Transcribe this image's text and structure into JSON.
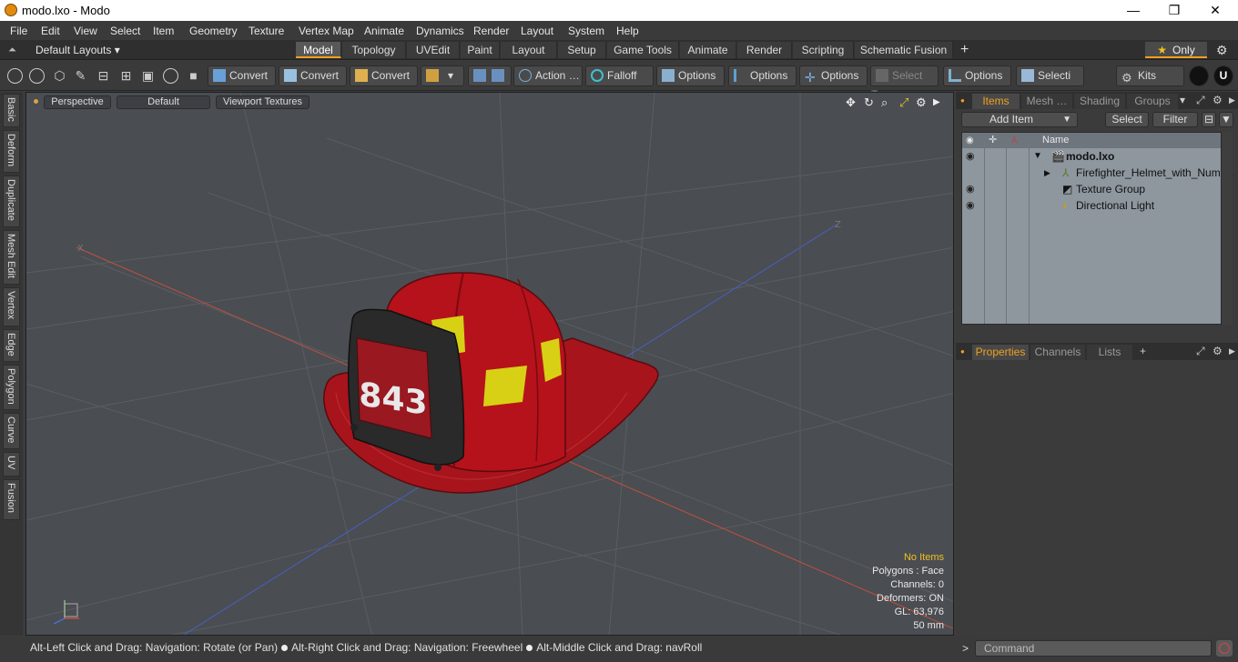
{
  "window": {
    "title": "modo.lxo - Modo",
    "minimize": "—",
    "maximize": "❐",
    "close": "✕"
  },
  "menu": [
    "File",
    "Edit",
    "View",
    "Select",
    "Item",
    "Geometry",
    "Texture",
    "Vertex Map",
    "Animate",
    "Dynamics",
    "Render",
    "Layout",
    "System",
    "Help"
  ],
  "layouts": {
    "label": "Default Layouts ▾"
  },
  "tabs": [
    "Model",
    "Topology",
    "UVEdit",
    "Paint",
    "Layout",
    "Setup",
    "Game Tools",
    "Animate",
    "Render",
    "Scripting",
    "Schematic Fusion"
  ],
  "active_tab": "Model",
  "only": {
    "label": "Only",
    "star": "★"
  },
  "toolbar": {
    "convert1": "Convert",
    "convert2": "Convert",
    "convert3": "Convert",
    "action": "Action",
    "action_more": "…",
    "falloff": "Falloff",
    "options1": "Options",
    "options2": "Options",
    "options3": "Options",
    "options4": "Options",
    "select_t": "Select T…",
    "selecti": "Selecti …",
    "kits": "Kits"
  },
  "left_tabs": [
    "Basic",
    "Deform",
    "Duplicate",
    "Mesh Edit",
    "Vertex",
    "Edge",
    "Polygon",
    "Curve",
    "UV",
    "Fusion"
  ],
  "viewport": {
    "view_mode": "Perspective",
    "shading": "Default",
    "textures": "Viewport Textures",
    "axis_labels": {
      "x": "X",
      "z": "Z"
    },
    "helmet_number": "843",
    "info": {
      "no_items": "No Items",
      "polygons": "Polygons : Face",
      "channels": "Channels: 0",
      "deformers": "Deformers: ON",
      "gl": "GL: 63,976",
      "size": "50 mm"
    }
  },
  "status": {
    "hint1": "Alt-Left Click and Drag: Navigation: Rotate (or Pan)",
    "hint2": "Alt-Right Click and Drag: Navigation: Freewheel",
    "hint3": "Alt-Middle Click and Drag: navRoll"
  },
  "items_panel": {
    "tabs": [
      "Items",
      "Mesh …",
      "Shading",
      "Groups"
    ],
    "active_tab": "Items",
    "add_item": "Add Item",
    "select": "Select",
    "filter": "Filter",
    "column_name": "Name",
    "rows": [
      {
        "name": "modo.lxo",
        "bold": true
      },
      {
        "name": "Firefighter_Helmet_with_Num …"
      },
      {
        "name": "Texture Group"
      },
      {
        "name": "Directional Light"
      }
    ]
  },
  "properties_panel": {
    "tabs": [
      "Properties",
      "Channels",
      "Lists"
    ],
    "active_tab": "Properties"
  },
  "command": {
    "placeholder": "Command",
    "prompt": ">"
  },
  "colors": {
    "accent": "#f0a020",
    "helmet_red": "#b5121b",
    "helmet_yellow": "#d8d015",
    "grid_bg": "#4a4d52"
  }
}
